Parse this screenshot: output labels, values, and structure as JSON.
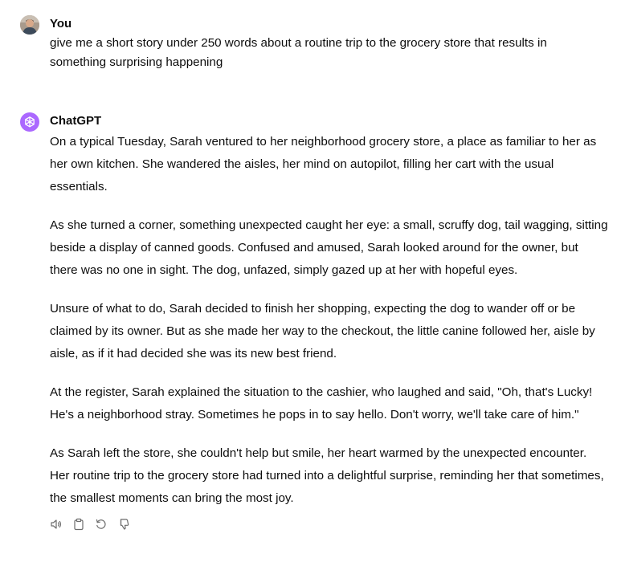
{
  "user_message": {
    "author": "You",
    "text": "give me a short story under 250 words about a routine trip to the grocery store that results in something surprising happening",
    "avatar_icon": "user-photo-avatar"
  },
  "assistant_message": {
    "author": "ChatGPT",
    "avatar_icon": "openai-logo-icon",
    "avatar_color": "#ab68ff",
    "paragraphs": [
      "On a typical Tuesday, Sarah ventured to her neighborhood grocery store, a place as familiar to her as her own kitchen. She wandered the aisles, her mind on autopilot, filling her cart with the usual essentials.",
      "As she turned a corner, something unexpected caught her eye: a small, scruffy dog, tail wagging, sitting beside a display of canned goods. Confused and amused, Sarah looked around for the owner, but there was no one in sight. The dog, unfazed, simply gazed up at her with hopeful eyes.",
      "Unsure of what to do, Sarah decided to finish her shopping, expecting the dog to wander off or be claimed by its owner. But as she made her way to the checkout, the little canine followed her, aisle by aisle, as if it had decided she was its new best friend.",
      "At the register, Sarah explained the situation to the cashier, who laughed and said, \"Oh, that's Lucky! He's a neighborhood stray. Sometimes he pops in to say hello. Don't worry, we'll take care of him.\"",
      "As Sarah left the store, she couldn't help but smile, her heart warmed by the unexpected encounter. Her routine trip to the grocery store had turned into a delightful surprise, reminding her that sometimes, the smallest moments can bring the most joy."
    ],
    "actions": [
      "read-aloud-icon",
      "copy-icon",
      "regenerate-icon",
      "thumbs-down-icon"
    ]
  }
}
